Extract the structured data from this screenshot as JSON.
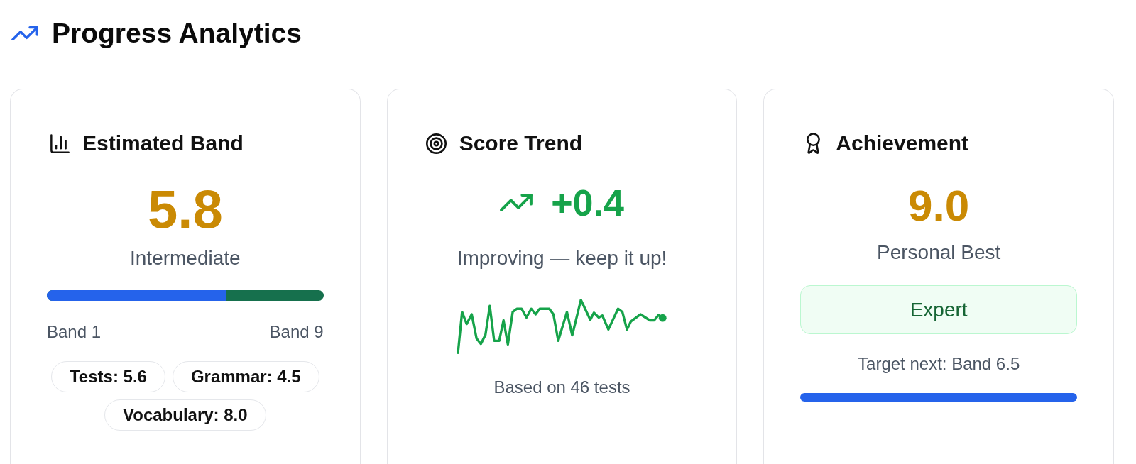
{
  "header": {
    "title": "Progress Analytics"
  },
  "cards": [
    {
      "kind": "band",
      "title": "Estimated Band",
      "score": "5.8",
      "label": "Intermediate",
      "level": 0.65,
      "scale_start": "Band 1",
      "scale_end": "Band 9",
      "chips": [
        "Tests: 5.6",
        "Grammar: 4.5",
        "Vocabulary: 8.0"
      ]
    },
    {
      "kind": "trend",
      "title": "Score Trend",
      "change": "+0.4",
      "message": "Improving — keep it up!",
      "footnote": "Based on 46 tests"
    },
    {
      "kind": "achievement",
      "title": "Achievement",
      "score": "9.0",
      "label": "Personal Best",
      "badge": "Expert",
      "target": "Target next: Band 6.5",
      "level": 1
    }
  ]
}
